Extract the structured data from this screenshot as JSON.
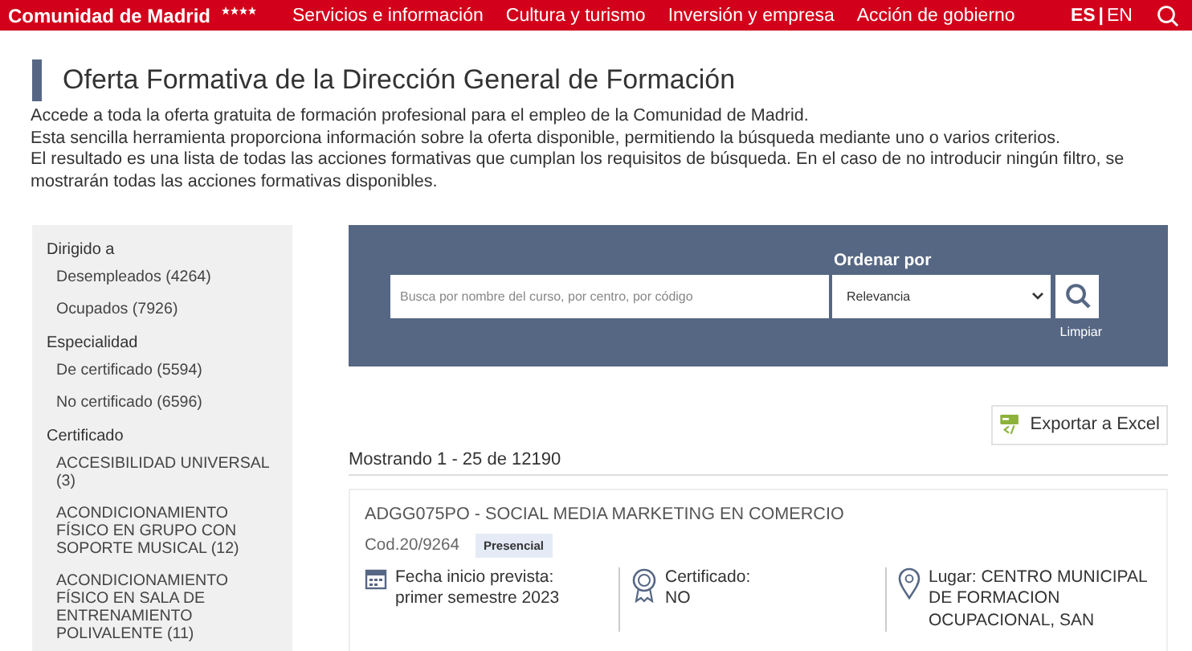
{
  "header": {
    "brand": "Comunidad de Madrid",
    "nav": [
      "Servicios e información",
      "Cultura y turismo",
      "Inversión y empresa",
      "Acción de gobierno"
    ],
    "languages": [
      {
        "label": "ES",
        "selected": true
      },
      {
        "label": "EN",
        "selected": false
      }
    ],
    "separator": "|"
  },
  "page": {
    "title": "Oferta Formativa de la Dirección General de Formación",
    "intro": [
      "Accede a toda la oferta gratuita de formación profesional para el empleo de la Comunidad de Madrid.",
      "Esta sencilla herramienta proporciona información sobre la oferta disponible, permitiendo la búsqueda mediante uno o varios criterios.",
      "El resultado es una lista de todas las acciones formativas que cumplan los requisitos de búsqueda. En el caso de no introducir ningún filtro, se mostrarán todas las acciones formativas disponibles."
    ]
  },
  "sidebar": {
    "groups": [
      {
        "title": "Dirigido a",
        "items": [
          "Desempleados (4264)",
          "Ocupados (7926)"
        ]
      },
      {
        "title": "Especialidad",
        "items": [
          "De certificado (5594)",
          "No certificado (6596)"
        ]
      },
      {
        "title": "Certificado",
        "items": [
          "ACCESIBILIDAD UNIVERSAL (3)",
          "ACONDICIONAMIENTO FÍSICO EN GRUPO CON SOPORTE MUSICAL (12)",
          "ACONDICIONAMIENTO FÍSICO EN SALA DE ENTRENAMIENTO POLIVALENTE (11)"
        ]
      }
    ]
  },
  "search": {
    "placeholder": "Busca por nombre del curso, por centro, por código",
    "sort_label": "Ordenar por",
    "sort_value": "Relevancia",
    "clear": "Limpiar"
  },
  "export": "Exportar a Excel",
  "results_count": "Mostrando 1 - 25 de 12190",
  "courses": [
    {
      "title": "ADGG075PO - SOCIAL MEDIA MARKETING EN COMERCIO",
      "code": "Cod.20/9264",
      "mode": "Presencial",
      "facts": [
        {
          "kind": "date",
          "label": "Fecha inicio prevista:",
          "value": "primer semestre 2023"
        },
        {
          "kind": "certificate",
          "label": "Certificado:",
          "value": "NO"
        },
        {
          "kind": "place",
          "label": "Lugar: CENTRO MUNICIPAL DE FORMACION OCUPACIONAL, SAN"
        }
      ]
    }
  ]
}
